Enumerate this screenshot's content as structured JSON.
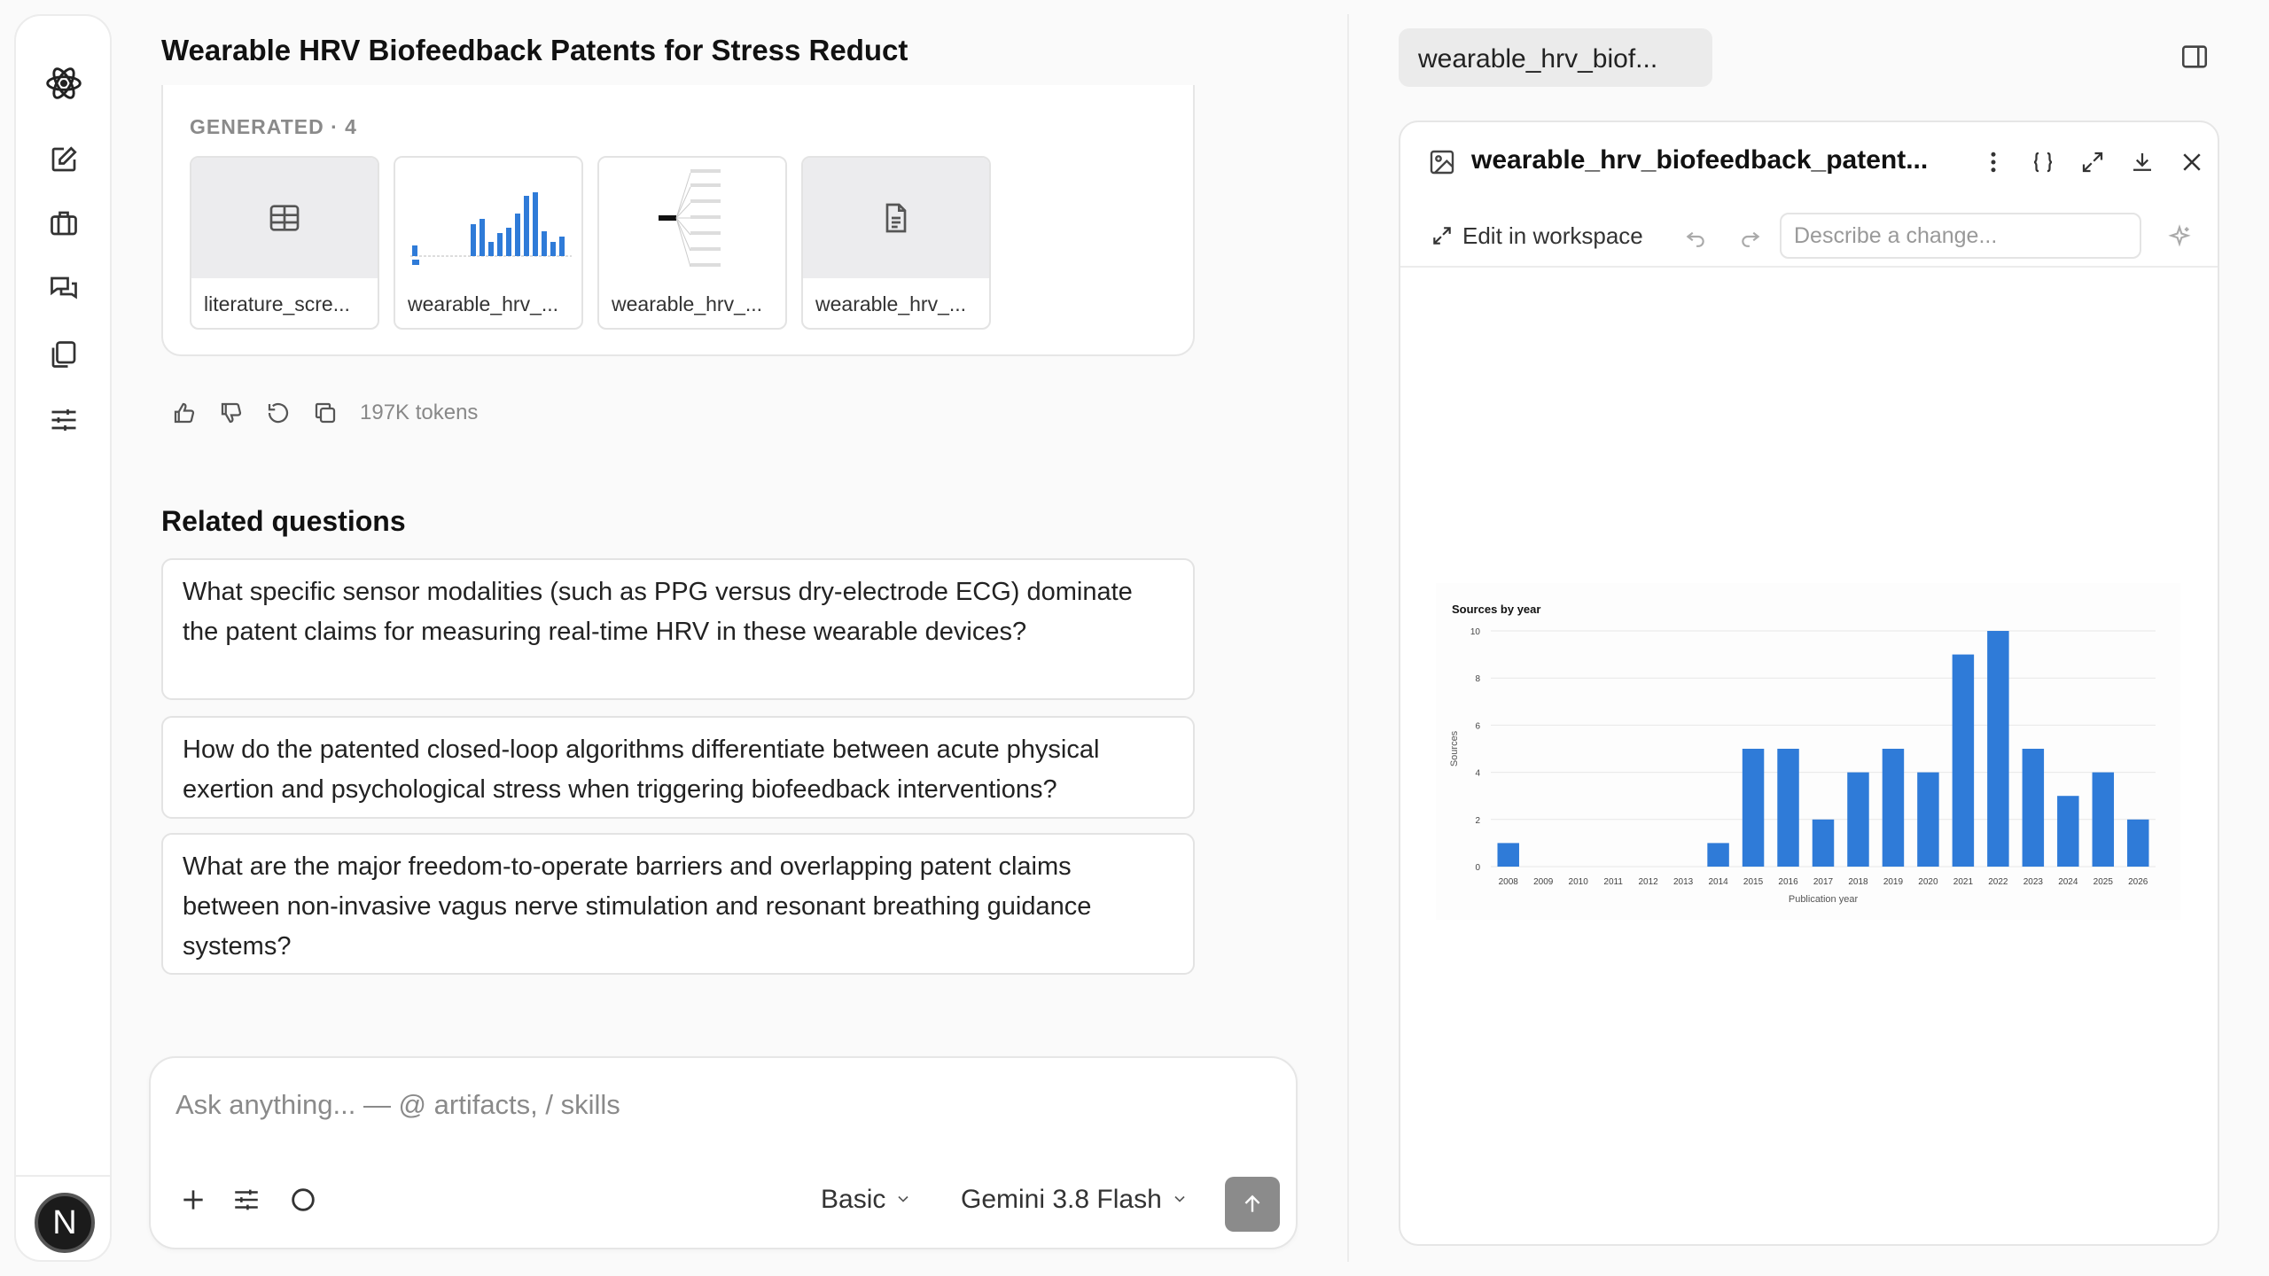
{
  "chat": {
    "title": "Wearable HRV Biofeedback Patents for Stress Reduct",
    "generated_label": "GENERATED · 4",
    "artifacts": [
      {
        "name": "literature_scre...",
        "kind": "table-icon"
      },
      {
        "name": "wearable_hrv_...",
        "kind": "chart-thumbnail"
      },
      {
        "name": "wearable_hrv_...",
        "kind": "diagram-thumbnail"
      },
      {
        "name": "wearable_hrv_...",
        "kind": "document-icon"
      }
    ],
    "tokens": "197K tokens",
    "related_title": "Related questions",
    "related": [
      "What specific sensor modalities (such as PPG versus dry-electrode ECG) dominate the patent claims for measuring real-time HRV in these wearable devices?",
      "How do the patented closed-loop algorithms differentiate between acute physical exertion and psychological stress when triggering biofeedback interventions?",
      "What are the major freedom-to-operate barriers and overlapping patent claims between non-invasive vagus nerve stimulation and resonant breathing guidance systems?"
    ]
  },
  "composer": {
    "placeholder": "Ask anything... — @ artifacts, / skills",
    "mode": "Basic",
    "model": "Gemini 3.8 Flash"
  },
  "user": {
    "avatar_letter": "N"
  },
  "viewer": {
    "tab_label": "wearable_hrv_biof...",
    "title": "wearable_hrv_biofeedback_patent...",
    "edit_label": "Edit in workspace",
    "describe_placeholder": "Describe a change..."
  },
  "chart_data": {
    "type": "bar",
    "title": "Sources by year",
    "xlabel": "Publication year",
    "ylabel": "Sources",
    "categories": [
      "2008",
      "2009",
      "2010",
      "2011",
      "2012",
      "2013",
      "2014",
      "2015",
      "2016",
      "2017",
      "2018",
      "2019",
      "2020",
      "2021",
      "2022",
      "2023",
      "2024",
      "2025",
      "2026"
    ],
    "values": [
      1,
      0,
      0,
      0,
      0,
      0,
      1,
      5,
      5,
      2,
      4,
      5,
      4,
      9,
      10,
      5,
      3,
      4,
      2
    ],
    "ylim": [
      0,
      10
    ],
    "yticks": [
      0,
      2,
      4,
      6,
      8,
      10
    ],
    "grid": true,
    "bar_color": "#2f7bd8"
  }
}
